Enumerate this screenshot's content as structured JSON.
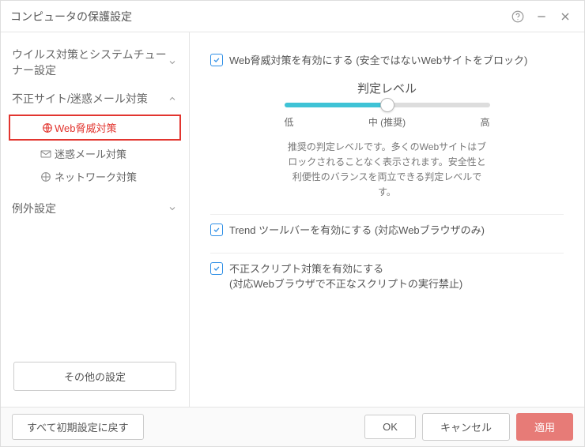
{
  "window": {
    "title": "コンピュータの保護設定"
  },
  "sidebar": {
    "cats": [
      {
        "label": "ウイルス対策とシステムチューナー設定",
        "expanded": false
      },
      {
        "label": "不正サイト/迷惑メール対策",
        "expanded": true,
        "subs": [
          {
            "label": "Web脅威対策",
            "icon": "globe-shield",
            "active": true
          },
          {
            "label": "迷惑メール対策",
            "icon": "mail",
            "active": false
          },
          {
            "label": "ネットワーク対策",
            "icon": "network",
            "active": false
          }
        ]
      },
      {
        "label": "例外設定",
        "expanded": false
      }
    ],
    "other_button": "その他の設定"
  },
  "main": {
    "web_threat": {
      "checkbox_label": "Web脅威対策を有効にする (安全ではないWebサイトをブロック)",
      "slider_title": "判定レベル",
      "slider_low": "低",
      "slider_mid": "中 (推奨)",
      "slider_high": "高",
      "slider_desc": "推奨の判定レベルです。多くのWebサイトはブロックされることなく表示されます。安全性と利便性のバランスを両立できる判定レベルです。"
    },
    "toolbar_checkbox": "Trend ツールバーを有効にする (対応Webブラウザのみ)",
    "script_checkbox_l1": "不正スクリプト対策を有効にする",
    "script_checkbox_l2": "(対応Webブラウザで不正なスクリプトの実行禁止)"
  },
  "footer": {
    "reset": "すべて初期設定に戻す",
    "ok": "OK",
    "cancel": "キャンセル",
    "apply": "適用"
  }
}
